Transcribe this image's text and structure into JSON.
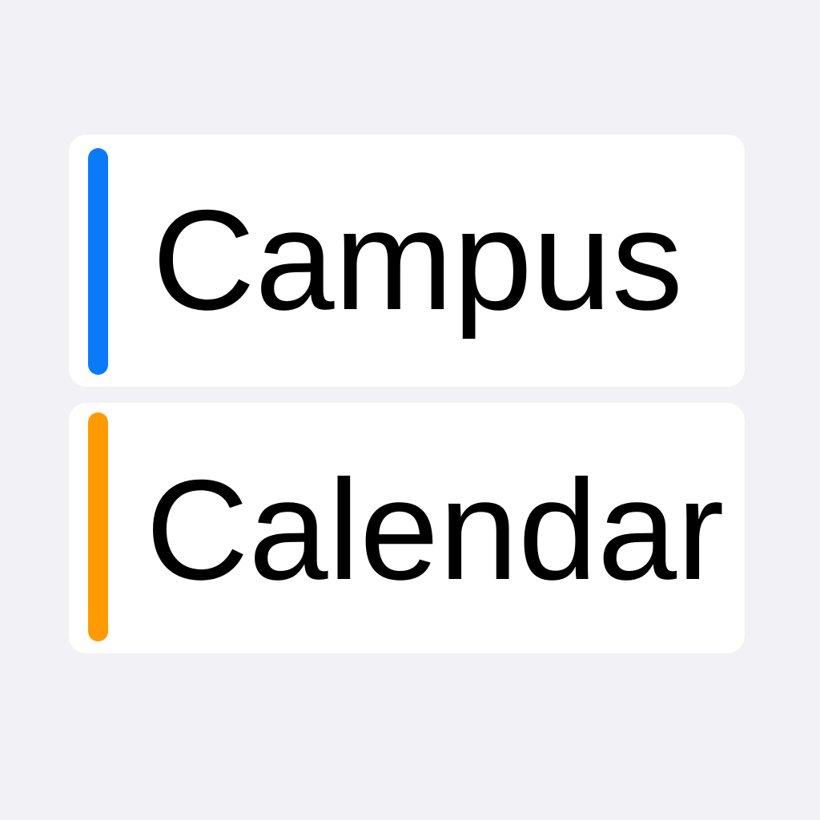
{
  "cards": [
    {
      "label": "Campus",
      "accent": "#0a7af8"
    },
    {
      "label": "Calendar",
      "accent": "#fe9b03"
    }
  ]
}
